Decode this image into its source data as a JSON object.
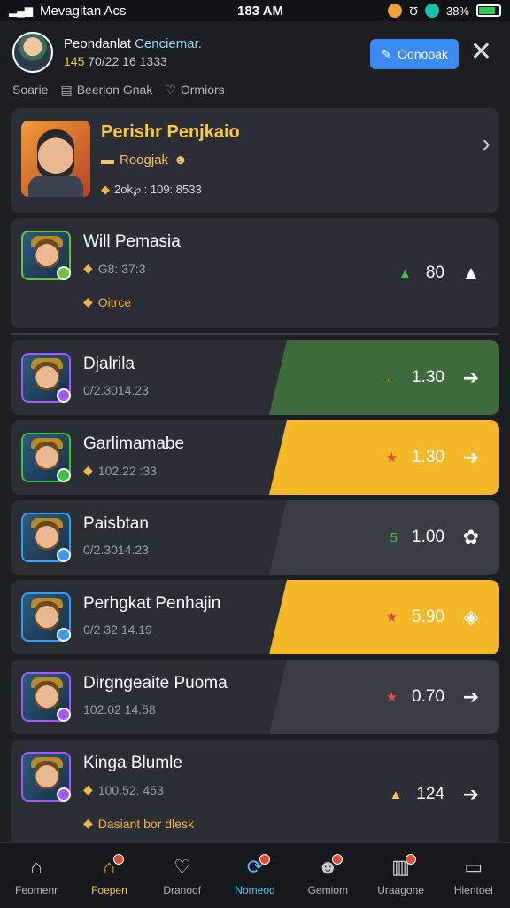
{
  "status_bar": {
    "carrier": "Mevagitan Acs",
    "time": "183 AM",
    "battery": "38%"
  },
  "header": {
    "name_prefix": "Peondanlat",
    "name_highlight": "Cenciemar.",
    "meta_num": "145",
    "meta_rest": "70/22 16 1333",
    "action_label": "Oonooak"
  },
  "tabs": [
    {
      "label": "Soarie"
    },
    {
      "label": "Beerion Gnak"
    },
    {
      "label": "Ormiors"
    }
  ],
  "featured": {
    "title": "Perishr Penjkaio",
    "sub": "Roogjak",
    "meta": "2ok℘ : 109: 8533"
  },
  "rows": [
    {
      "title": "Will Pemasia",
      "meta": "G8: 37:3",
      "extra": "Oitrce",
      "amount": "80",
      "lead": "▲",
      "lead_color": "#3cc43c",
      "pill_color": "transparent",
      "tall": true,
      "arrow": "▲",
      "meta_icon": "◆"
    },
    {
      "title": "Djalrila",
      "meta": "0/2.3014.23",
      "amount": "1.30",
      "lead": "←",
      "lead_color": "#f7c948",
      "pill_color": "#3f6a3d",
      "arrow": "➔",
      "meta_icon": ""
    },
    {
      "title": "Garlimamabe",
      "meta": "102.22 :33",
      "amount": "1.30",
      "lead": "★",
      "lead_color": "#e34b3b",
      "pill_color": "#f5b829",
      "arrow": "➔",
      "meta_icon": "◆"
    },
    {
      "title": "Paisbtan",
      "meta": "0/2.3014.23",
      "amount": "1.00",
      "lead": "5",
      "lead_color": "#3cc43c",
      "pill_color": "#3a3d44",
      "arrow": "✿",
      "meta_icon": ""
    },
    {
      "title": "Perhgkat Penhajin",
      "meta": "0/2 32 14.19",
      "amount": "5.90",
      "lead": "★",
      "lead_color": "#e34b3b",
      "pill_color": "#f5b829",
      "arrow": "◈",
      "meta_icon": ""
    },
    {
      "title": "Dirgngeaite Puoma",
      "meta": "102.02 14.58",
      "amount": "0.70",
      "lead": "★",
      "lead_color": "#e34b3b",
      "pill_color": "#3a3d44",
      "arrow": "➔",
      "meta_icon": ""
    },
    {
      "title": "Kinga Blumle",
      "meta": "100.52. 453",
      "extra": "Dasiant bor dlesk",
      "amount": "124",
      "lead": "▲",
      "lead_color": "#f7c948",
      "pill_color": "transparent",
      "tall": true,
      "arrow": "➔",
      "meta_icon": "◆"
    }
  ],
  "tabbar": [
    {
      "label": "Feomenr",
      "icon": "home-icon"
    },
    {
      "label": "Foepen",
      "icon": "shop-icon"
    },
    {
      "label": "Dranoof",
      "icon": "heart-icon"
    },
    {
      "label": "Nomeod",
      "icon": "refresh-icon"
    },
    {
      "label": "Gemiom",
      "icon": "user-icon"
    },
    {
      "label": "Uraagone",
      "icon": "chart-icon"
    },
    {
      "label": "Hientoel",
      "icon": "window-icon"
    }
  ]
}
